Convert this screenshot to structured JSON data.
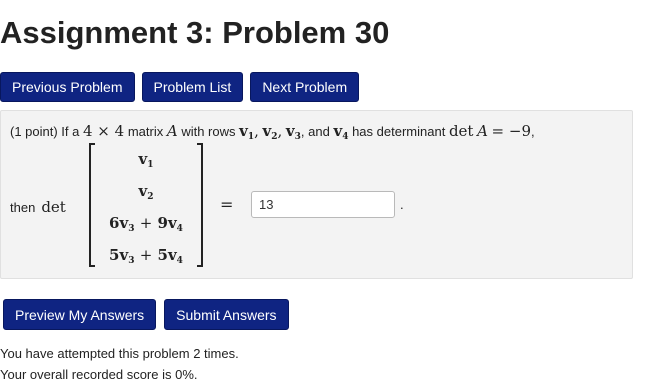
{
  "header": {
    "title": "Assignment 3: Problem 30"
  },
  "nav": {
    "previous_label": "Previous Problem",
    "list_label": "Problem List",
    "next_label": "Next Problem"
  },
  "problem": {
    "points": "(1 point) If a",
    "dims": "4 × 4",
    "matrix_word": "matrix",
    "matrix_var": "A",
    "with_rows": "with rows",
    "v": "v",
    "i1": "1",
    "i2": "2",
    "i3": "3",
    "i4": "4",
    "comma": ",",
    "and_word": "and",
    "has_det_text": "has determinant",
    "det_op": "det",
    "det_var": "A",
    "det_eq": "= −9",
    "end_comma": ",",
    "then_word": "then",
    "det_label": "det",
    "rows": {
      "r1_vec": "v",
      "r1_sub": "1",
      "r2_vec": "v",
      "r2_sub": "2",
      "r3_coef1": "6",
      "r3_vec1": "v",
      "r3_sub1": "3",
      "r3_plus": "+",
      "r3_coef2": "9",
      "r3_vec2": "v",
      "r3_sub2": "4",
      "r4_coef1": "5",
      "r4_vec1": "v",
      "r4_sub1": "3",
      "r4_plus": "+",
      "r4_coef2": "5",
      "r4_vec2": "v",
      "r4_sub2": "4"
    },
    "equals": "=",
    "answer_value": "13",
    "period": "."
  },
  "actions": {
    "preview_label": "Preview My Answers",
    "submit_label": "Submit Answers"
  },
  "status": {
    "attempts": "You have attempted this problem 2 times.",
    "score": "Your overall recorded score is 0%."
  },
  "colors": {
    "button_bg": "#0f2482",
    "problem_bg": "#f3f3f3"
  }
}
